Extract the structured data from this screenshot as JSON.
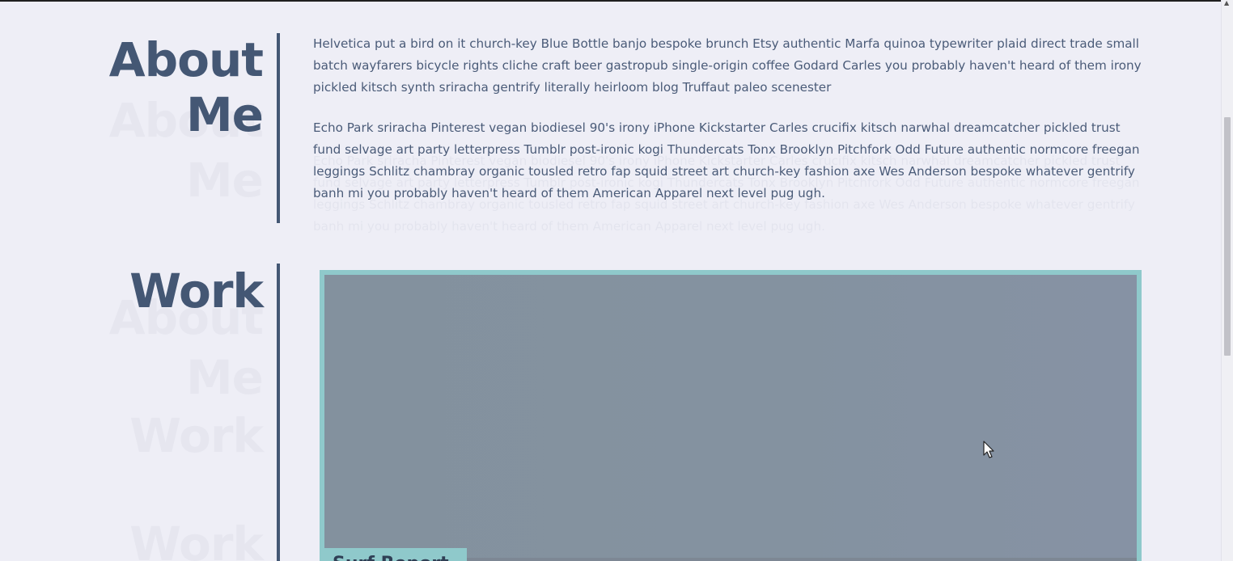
{
  "about": {
    "title_line1": "About",
    "title_line2": "Me",
    "paragraph1": "Helvetica put a bird on it church-key Blue Bottle banjo bespoke brunch Etsy authentic Marfa quinoa typewriter plaid direct trade small batch wayfarers bicycle rights cliche craft beer gastropub single-origin coffee Godard Carles you probably haven't heard of them irony pickled kitsch synth sriracha gentrify literally heirloom blog Truffaut paleo scenester",
    "paragraph2": "Echo Park sriracha Pinterest vegan biodiesel 90's irony iPhone Kickstarter Carles crucifix kitsch narwhal dreamcatcher pickled trust fund selvage art party letterpress Tumblr post-ironic kogi Thundercats Tonx Brooklyn Pitchfork Odd Future authentic normcore freegan leggings Schlitz chambray organic tousled retro fap squid street art church-key fashion axe Wes Anderson bespoke whatever gentrify banh mi you probably haven't heard of them American Apparel next level pug ugh."
  },
  "work": {
    "title": "Work",
    "card_label": "Surf Report"
  },
  "colors": {
    "accent": "#445774",
    "card_border": "#8fc9cb",
    "background": "#eeeef6"
  }
}
